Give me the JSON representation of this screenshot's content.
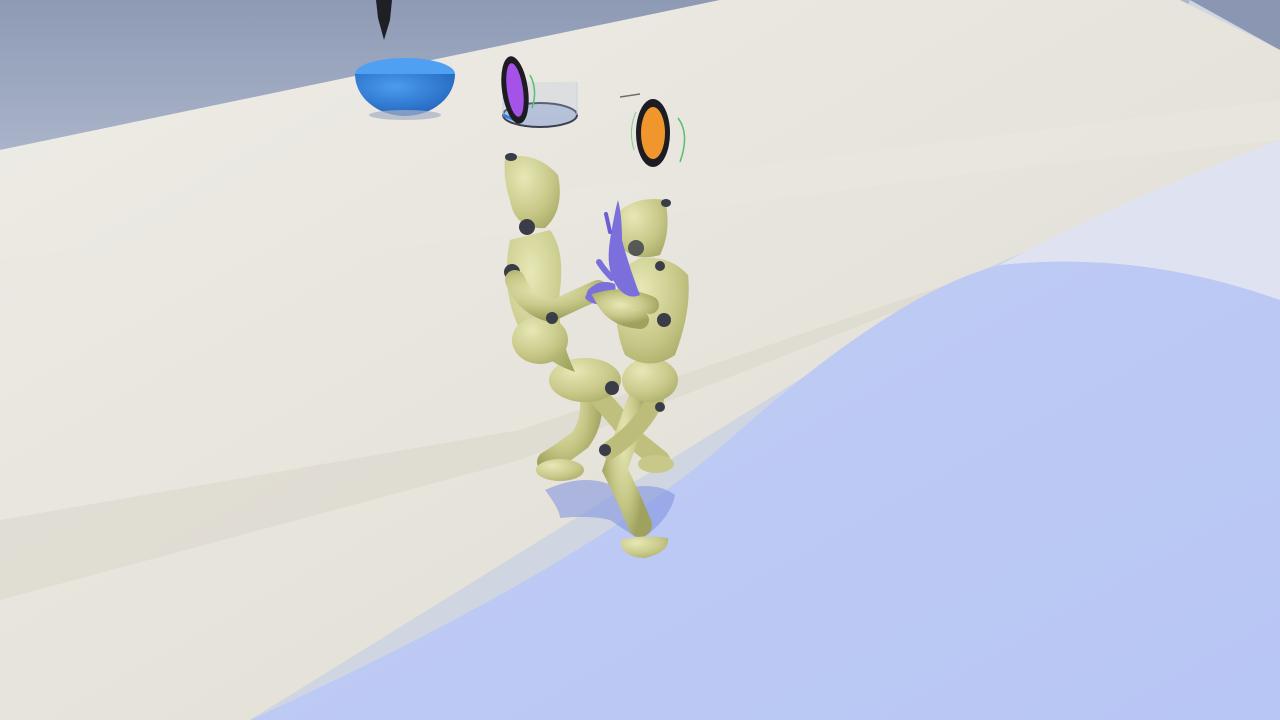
{
  "scene": {
    "colors": {
      "wall": "#9aa6be",
      "wall_dark": "#7d8aa6",
      "floor": "#e8e6de",
      "floor_shade": "#d9d6cb",
      "platform": "#bcc9f4",
      "platform_light": "#c9d4f6",
      "mannequin_body": "#c9c98a",
      "mannequin_shadow": "#a9aa64",
      "mannequin_highlight": "#e2e2b0",
      "joint": "#3a3d48",
      "hand_purple": "#7b6fdc",
      "blue_bowl": "#2f7fd8",
      "purple_marker": "#a452e8",
      "orange_marker": "#f0962c",
      "green_ring": "#56c070",
      "shadow": "#7d90e0"
    },
    "objects": [
      "blue-bowl",
      "purple-target-marker",
      "orange-target-marker",
      "transparent-cylinder",
      "mannequin-left",
      "mannequin-right",
      "black-spike"
    ]
  }
}
